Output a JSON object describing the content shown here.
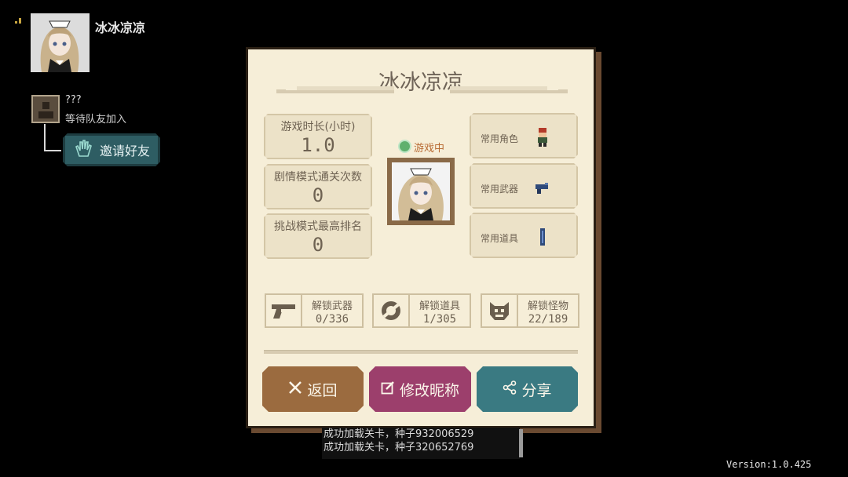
{
  "player": {
    "name": "冰冰凉凉"
  },
  "friend": {
    "name": "???",
    "status": "等待队友加入",
    "invite_label": "邀请好友"
  },
  "profile": {
    "title": "冰冰凉凉",
    "status_text": "游戏中",
    "stats": [
      {
        "label": "游戏时长(小时)",
        "value": "1.0"
      },
      {
        "label": "剧情模式通关次数",
        "value": "0"
      },
      {
        "label": "挑战模式最高排名",
        "value": "0"
      }
    ],
    "common": [
      {
        "label": "常用角色",
        "icon": "character-sprite-icon"
      },
      {
        "label": "常用武器",
        "icon": "weapon-sprite-icon"
      },
      {
        "label": "常用道具",
        "icon": "item-sprite-icon"
      }
    ],
    "unlocks": [
      {
        "label": "解锁武器",
        "count": "0/336",
        "icon": "pistol-icon"
      },
      {
        "label": "解锁道具",
        "count": "1/305",
        "icon": "ring-icon"
      },
      {
        "label": "解锁怪物",
        "count": "22/189",
        "icon": "monster-icon"
      }
    ],
    "buttons": {
      "back": "返回",
      "edit_name": "修改昵称",
      "share": "分享"
    }
  },
  "log": [
    "成功加载关卡，种子932006529",
    "成功加载关卡，种子320652769"
  ],
  "version": "Version:1.0.425",
  "colors": {
    "panel_bg": "#f6eed8",
    "back_button": "#9b6b3f",
    "edit_button": "#9c3f6c",
    "share_button": "#3a7a82",
    "invite_button": "#2e5d63",
    "status_online": "#5fb06e"
  }
}
